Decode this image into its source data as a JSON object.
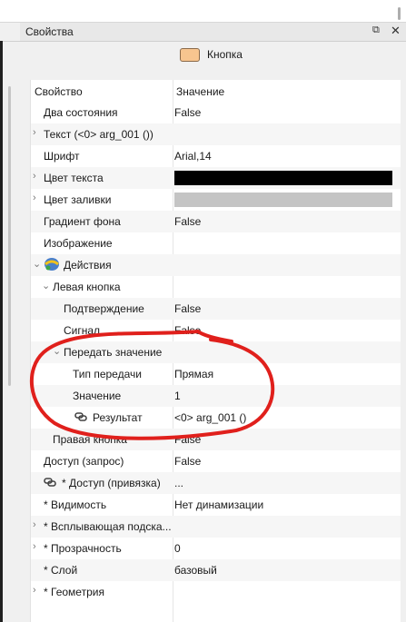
{
  "panel": {
    "title": "Свойства",
    "float_icon": "float-window-icon",
    "close_icon": "close-icon"
  },
  "widget": {
    "name": "Кнопка",
    "swatch_color": "#f7c58f"
  },
  "table": {
    "header_property": "Свойство",
    "header_value": "Значение",
    "rows": [
      {
        "name": "Два состояния",
        "value": "False"
      },
      {
        "name": "Текст (<0> arg_001 ())",
        "value": "",
        "expandable": true
      },
      {
        "name": "Шрифт",
        "value": "Arial,14"
      },
      {
        "name": "Цвет текста",
        "value": "",
        "color": "#000000",
        "expandable": true
      },
      {
        "name": "Цвет заливки",
        "value": "",
        "color": "#c4c4c4",
        "expandable": true
      },
      {
        "name": "Градиент фона",
        "value": "False"
      },
      {
        "name": "Изображение",
        "value": ""
      },
      {
        "name": "Действия",
        "value": "",
        "icon": "actions-icon",
        "expanded": true
      },
      {
        "name": "Левая кнопка",
        "value": "",
        "expanded": true
      },
      {
        "name": "Подтверждение",
        "value": "False"
      },
      {
        "name": "Сигнал",
        "value": "False"
      },
      {
        "name": "Передать значение",
        "value": "",
        "expanded": true
      },
      {
        "name": "Тип передачи",
        "value": "Прямая"
      },
      {
        "name": "Значение",
        "value": "1"
      },
      {
        "name": "Результат",
        "value": "<0> arg_001 ()",
        "icon": "link-icon"
      },
      {
        "name": "Правая кнопка",
        "value": "False"
      },
      {
        "name": "Доступ (запрос)",
        "value": "False"
      },
      {
        "name": "* Доступ (привязка)",
        "value": "...",
        "icon": "link-icon"
      },
      {
        "name": "* Видимость",
        "value": "Нет динамизации"
      },
      {
        "name": "* Всплывающая подска...",
        "value": "",
        "expandable": true
      },
      {
        "name": "* Прозрачность",
        "value": "0",
        "expandable": true
      },
      {
        "name": "* Слой",
        "value": "базовый"
      },
      {
        "name": "* Геометрия",
        "value": "",
        "expandable": true
      }
    ]
  },
  "colors": {
    "annotation": "#e0201c",
    "header_bg": "#e8e8e8",
    "alt_row": "#f6f6f6"
  }
}
